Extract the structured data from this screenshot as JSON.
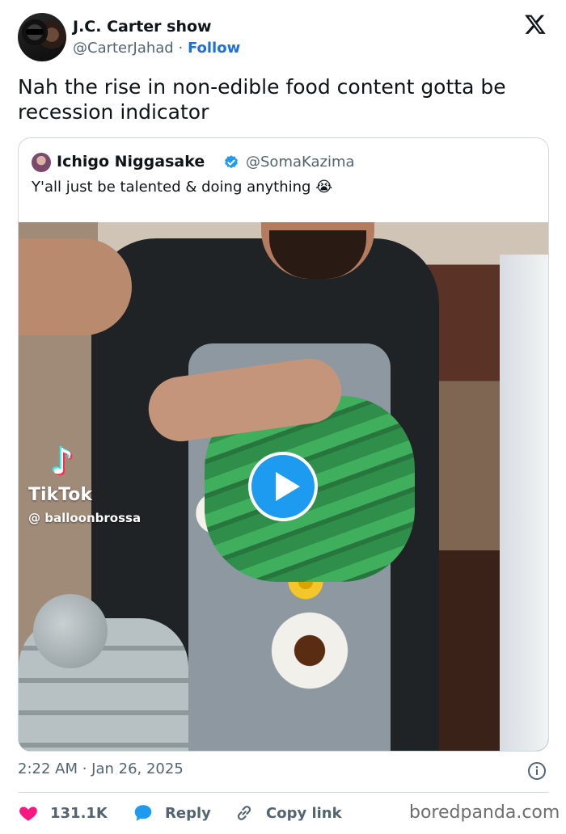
{
  "author": {
    "name": "J.C. Carter show",
    "handle": "@CarterJahad",
    "separator": "·",
    "follow_label": "Follow"
  },
  "tweet": {
    "text": "Nah the rise in non-edible food content gotta be recession indicator"
  },
  "quoted": {
    "name": "Ichigo Niggasake",
    "handle": "@SomaKazima",
    "text": "Y'all just be talented & doing anything 😭",
    "verified": true,
    "video": {
      "overlay_brand": "TikTok",
      "overlay_user": "@ balloonbrossa"
    }
  },
  "meta": {
    "timestamp": "2:22 AM · Jan 26, 2025"
  },
  "actions": {
    "likes": "131.1K",
    "reply_label": "Reply",
    "copy_label": "Copy link"
  },
  "watermark": "boredpanda.com",
  "colors": {
    "accent": "#1d9bf0",
    "follow": "#1d6fdc",
    "like": "#f91880",
    "muted": "#536471",
    "text": "#0f1419",
    "border": "#cfd9de"
  },
  "icons": [
    "x-logo-icon",
    "verified-badge-icon",
    "play-icon",
    "info-icon",
    "heart-icon",
    "reply-bubble-icon",
    "link-icon",
    "tiktok-note-icon"
  ]
}
